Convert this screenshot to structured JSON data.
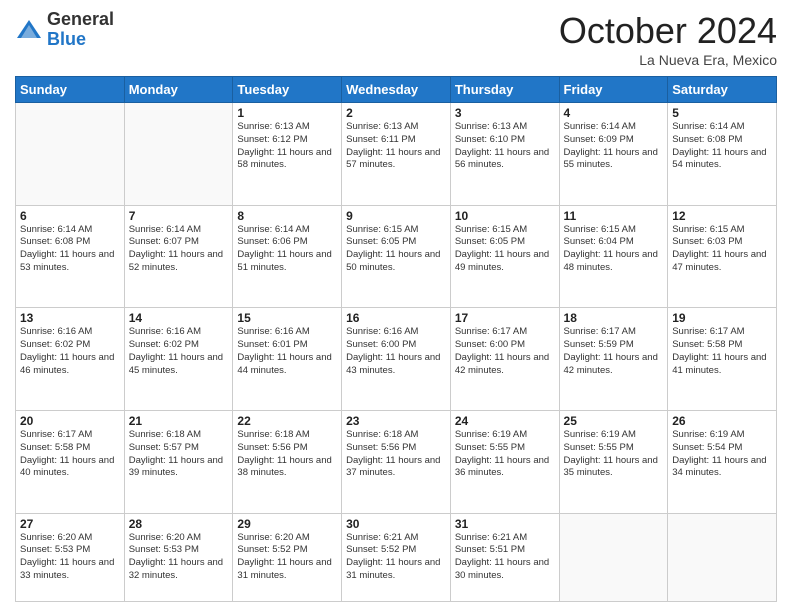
{
  "header": {
    "logo_general": "General",
    "logo_blue": "Blue",
    "month_title": "October 2024",
    "location": "La Nueva Era, Mexico"
  },
  "days_of_week": [
    "Sunday",
    "Monday",
    "Tuesday",
    "Wednesday",
    "Thursday",
    "Friday",
    "Saturday"
  ],
  "weeks": [
    [
      {
        "day": "",
        "info": ""
      },
      {
        "day": "",
        "info": ""
      },
      {
        "day": "1",
        "info": "Sunrise: 6:13 AM\nSunset: 6:12 PM\nDaylight: 11 hours and 58 minutes."
      },
      {
        "day": "2",
        "info": "Sunrise: 6:13 AM\nSunset: 6:11 PM\nDaylight: 11 hours and 57 minutes."
      },
      {
        "day": "3",
        "info": "Sunrise: 6:13 AM\nSunset: 6:10 PM\nDaylight: 11 hours and 56 minutes."
      },
      {
        "day": "4",
        "info": "Sunrise: 6:14 AM\nSunset: 6:09 PM\nDaylight: 11 hours and 55 minutes."
      },
      {
        "day": "5",
        "info": "Sunrise: 6:14 AM\nSunset: 6:08 PM\nDaylight: 11 hours and 54 minutes."
      }
    ],
    [
      {
        "day": "6",
        "info": "Sunrise: 6:14 AM\nSunset: 6:08 PM\nDaylight: 11 hours and 53 minutes."
      },
      {
        "day": "7",
        "info": "Sunrise: 6:14 AM\nSunset: 6:07 PM\nDaylight: 11 hours and 52 minutes."
      },
      {
        "day": "8",
        "info": "Sunrise: 6:14 AM\nSunset: 6:06 PM\nDaylight: 11 hours and 51 minutes."
      },
      {
        "day": "9",
        "info": "Sunrise: 6:15 AM\nSunset: 6:05 PM\nDaylight: 11 hours and 50 minutes."
      },
      {
        "day": "10",
        "info": "Sunrise: 6:15 AM\nSunset: 6:05 PM\nDaylight: 11 hours and 49 minutes."
      },
      {
        "day": "11",
        "info": "Sunrise: 6:15 AM\nSunset: 6:04 PM\nDaylight: 11 hours and 48 minutes."
      },
      {
        "day": "12",
        "info": "Sunrise: 6:15 AM\nSunset: 6:03 PM\nDaylight: 11 hours and 47 minutes."
      }
    ],
    [
      {
        "day": "13",
        "info": "Sunrise: 6:16 AM\nSunset: 6:02 PM\nDaylight: 11 hours and 46 minutes."
      },
      {
        "day": "14",
        "info": "Sunrise: 6:16 AM\nSunset: 6:02 PM\nDaylight: 11 hours and 45 minutes."
      },
      {
        "day": "15",
        "info": "Sunrise: 6:16 AM\nSunset: 6:01 PM\nDaylight: 11 hours and 44 minutes."
      },
      {
        "day": "16",
        "info": "Sunrise: 6:16 AM\nSunset: 6:00 PM\nDaylight: 11 hours and 43 minutes."
      },
      {
        "day": "17",
        "info": "Sunrise: 6:17 AM\nSunset: 6:00 PM\nDaylight: 11 hours and 42 minutes."
      },
      {
        "day": "18",
        "info": "Sunrise: 6:17 AM\nSunset: 5:59 PM\nDaylight: 11 hours and 42 minutes."
      },
      {
        "day": "19",
        "info": "Sunrise: 6:17 AM\nSunset: 5:58 PM\nDaylight: 11 hours and 41 minutes."
      }
    ],
    [
      {
        "day": "20",
        "info": "Sunrise: 6:17 AM\nSunset: 5:58 PM\nDaylight: 11 hours and 40 minutes."
      },
      {
        "day": "21",
        "info": "Sunrise: 6:18 AM\nSunset: 5:57 PM\nDaylight: 11 hours and 39 minutes."
      },
      {
        "day": "22",
        "info": "Sunrise: 6:18 AM\nSunset: 5:56 PM\nDaylight: 11 hours and 38 minutes."
      },
      {
        "day": "23",
        "info": "Sunrise: 6:18 AM\nSunset: 5:56 PM\nDaylight: 11 hours and 37 minutes."
      },
      {
        "day": "24",
        "info": "Sunrise: 6:19 AM\nSunset: 5:55 PM\nDaylight: 11 hours and 36 minutes."
      },
      {
        "day": "25",
        "info": "Sunrise: 6:19 AM\nSunset: 5:55 PM\nDaylight: 11 hours and 35 minutes."
      },
      {
        "day": "26",
        "info": "Sunrise: 6:19 AM\nSunset: 5:54 PM\nDaylight: 11 hours and 34 minutes."
      }
    ],
    [
      {
        "day": "27",
        "info": "Sunrise: 6:20 AM\nSunset: 5:53 PM\nDaylight: 11 hours and 33 minutes."
      },
      {
        "day": "28",
        "info": "Sunrise: 6:20 AM\nSunset: 5:53 PM\nDaylight: 11 hours and 32 minutes."
      },
      {
        "day": "29",
        "info": "Sunrise: 6:20 AM\nSunset: 5:52 PM\nDaylight: 11 hours and 31 minutes."
      },
      {
        "day": "30",
        "info": "Sunrise: 6:21 AM\nSunset: 5:52 PM\nDaylight: 11 hours and 31 minutes."
      },
      {
        "day": "31",
        "info": "Sunrise: 6:21 AM\nSunset: 5:51 PM\nDaylight: 11 hours and 30 minutes."
      },
      {
        "day": "",
        "info": ""
      },
      {
        "day": "",
        "info": ""
      }
    ]
  ]
}
